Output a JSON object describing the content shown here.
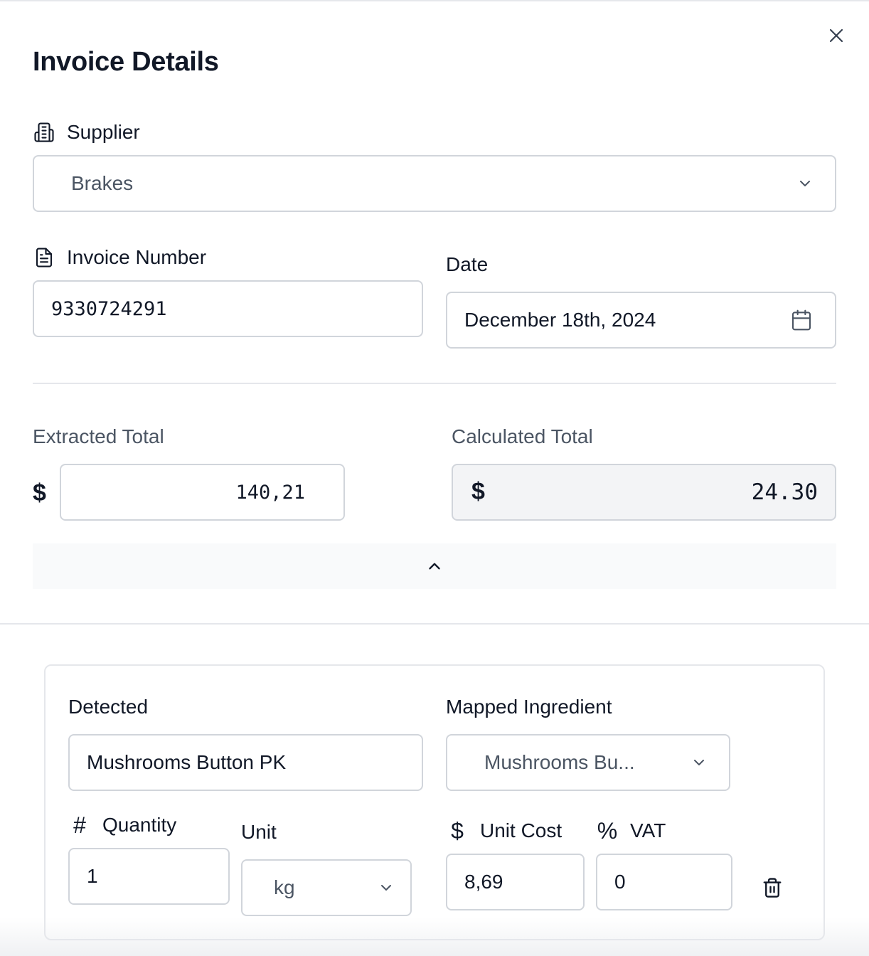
{
  "dialog": {
    "title": "Invoice Details"
  },
  "supplier": {
    "label": "Supplier",
    "selected": "Brakes"
  },
  "invoice_number": {
    "label": "Invoice Number",
    "value": "9330724291"
  },
  "date": {
    "label": "Date",
    "value": "December 18th, 2024"
  },
  "totals": {
    "extracted_label": "Extracted Total",
    "extracted_currency": "$",
    "extracted_value": "140,21",
    "calculated_label": "Calculated Total",
    "calculated_currency": "$",
    "calculated_value": "24.30"
  },
  "line_item": {
    "detected_label": "Detected",
    "detected_value": "Mushrooms Button PK",
    "mapped_label": "Mapped Ingredient",
    "mapped_value": "Mushrooms Bu...",
    "quantity_icon": "#",
    "quantity_label": "Quantity",
    "quantity_value": "1",
    "unit_label": "Unit",
    "unit_value": "kg",
    "unit_cost_icon": "$",
    "unit_cost_label": "Unit Cost",
    "unit_cost_value": "8,69",
    "vat_icon": "%",
    "vat_label": "VAT",
    "vat_value": "0"
  },
  "icons": {
    "close": "close-icon",
    "supplier": "building-icon",
    "invoice": "file-text-icon",
    "calendar": "calendar-icon",
    "collapse": "chevron-up-icon",
    "delete": "trash-icon"
  },
  "colors": {
    "border": "#d1d5db",
    "divider": "#e5e7eb",
    "readonly_bg": "#f3f4f6",
    "collapse_bg": "#f9fafb",
    "muted_text": "#4b5563"
  }
}
